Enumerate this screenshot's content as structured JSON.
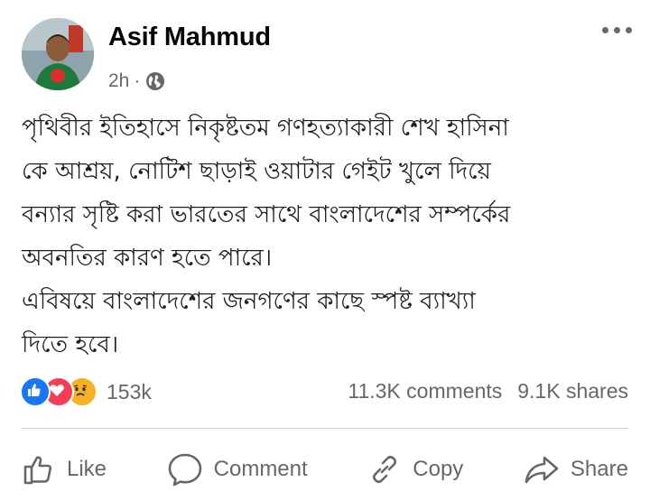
{
  "post": {
    "author": "Asif Mahmud",
    "time": "2h",
    "separator": "·",
    "privacy_icon": "globe-icon",
    "menu_icon": "more-horizontal-icon",
    "text_lines": [
      "পৃথিবীর ইতিহাসে নিকৃষ্টতম গণহত্যাকারী শেখ হাসিনা",
      "কে আশ্রয়, নোটিশ ছাড়াই ওয়াটার গেইট খুলে দিয়ে",
      "বন্যার সৃষ্টি করা ভারতের সাথে বাংলাদেশের সম্পর্কের",
      "অবনতির কারণ হতে পারে।",
      "এবিষয়ে বাংলাদেশের জনগণের কাছে স্পষ্ট ব্যাখ্যা",
      "দিতে হবে।"
    ]
  },
  "stats": {
    "reactions": [
      "like",
      "love",
      "sad"
    ],
    "reaction_count": "153k",
    "comments": "11.3K comments",
    "shares": "9.1K shares"
  },
  "actions": {
    "like": "Like",
    "comment": "Comment",
    "copy": "Copy",
    "share": "Share"
  },
  "colors": {
    "like_blue": "#1877f2",
    "love_red": "#f33e58",
    "sad_yellow": "#f7b125",
    "secondary_text": "#65676b"
  }
}
